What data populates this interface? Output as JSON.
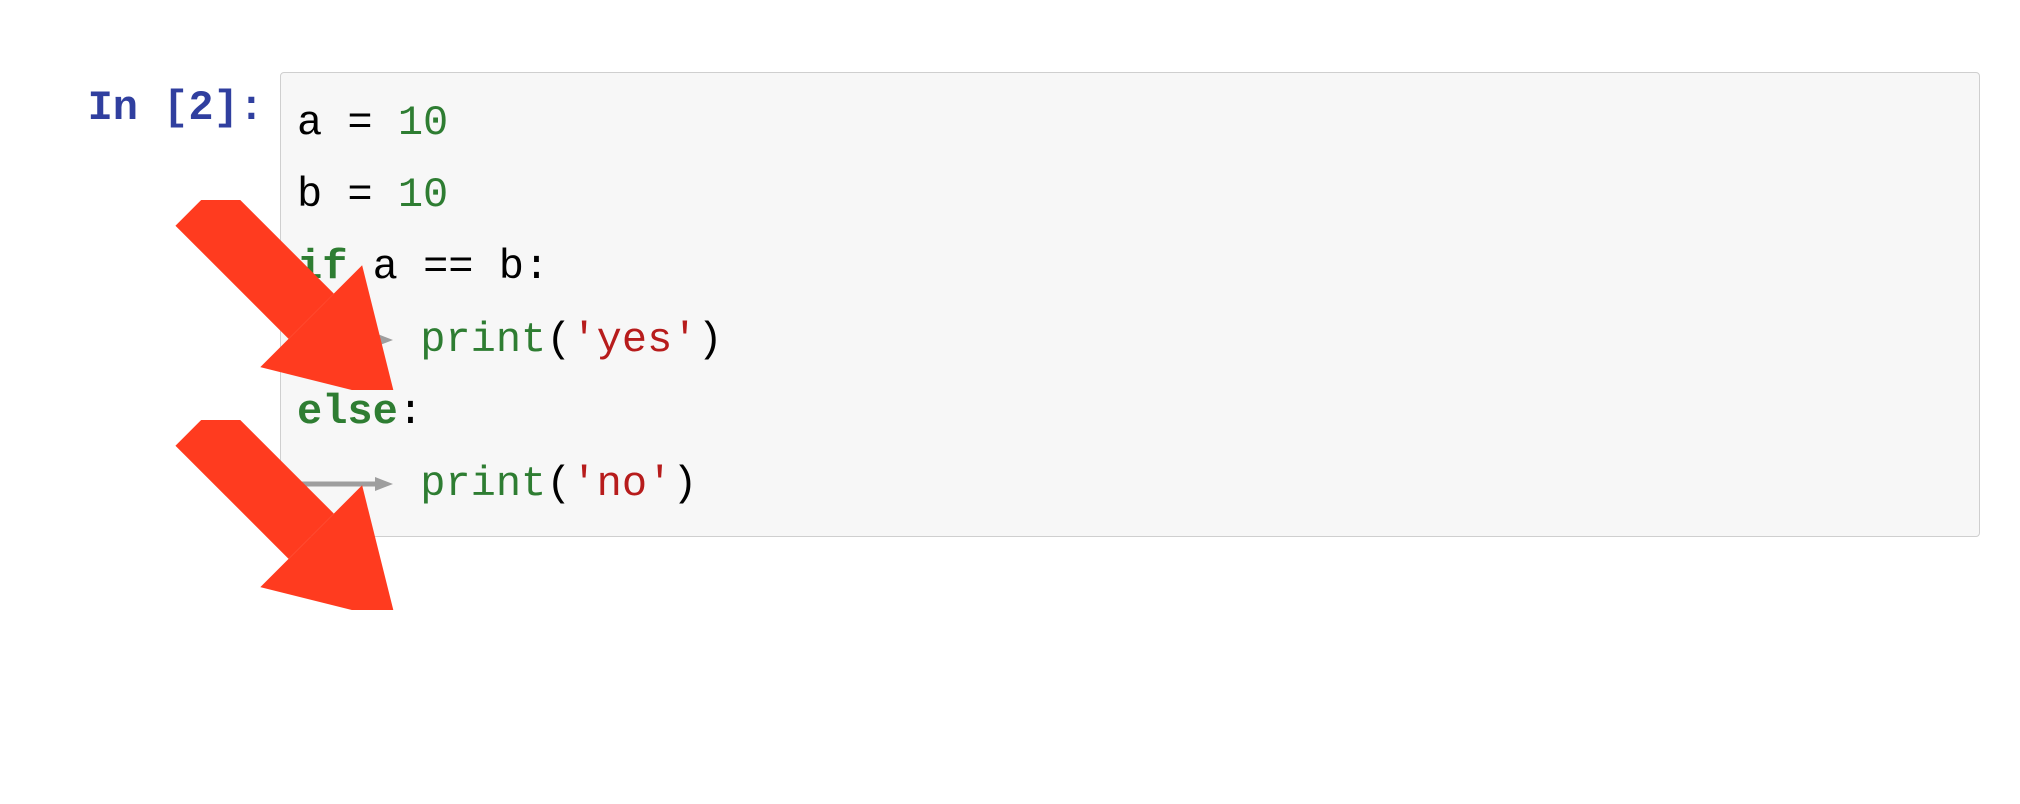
{
  "prompt": {
    "label": "In [2]:"
  },
  "code": {
    "line1": {
      "var": "a",
      "assign": " = ",
      "val": "10"
    },
    "line2": {
      "var": "b",
      "assign": " = ",
      "val": "10"
    },
    "line3": {
      "kw": "if",
      "space1": " ",
      "lhs": "a",
      "op": " == ",
      "rhs": "b",
      "colon": ":"
    },
    "line4": {
      "fn": "print",
      "open": "(",
      "str": "'yes'",
      "close": ")"
    },
    "line5": {
      "kw": "else",
      "colon": ":"
    },
    "line6": {
      "fn": "print",
      "open": "(",
      "str": "'no'",
      "close": ")"
    }
  }
}
